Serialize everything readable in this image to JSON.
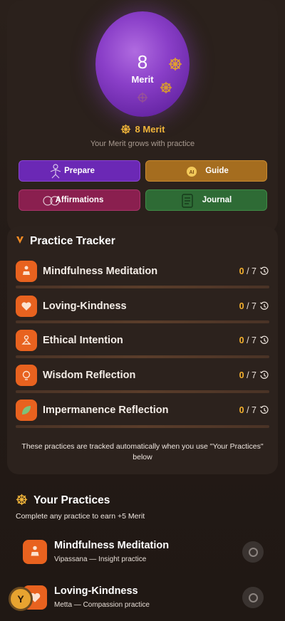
{
  "merit": {
    "value": "8",
    "label": "Merit",
    "summary": "8 Merit",
    "subtitle": "Your Merit grows with practice"
  },
  "actions": [
    {
      "label": "Prepare",
      "icon": "meditating-figure-icon",
      "color": "#6b28b5"
    },
    {
      "label": "Guide",
      "icon": "ai-guide-icon",
      "color": "#a56d1f"
    },
    {
      "label": "Affirmations",
      "icon": "speaking-heads-icon",
      "color": "#8a1f4f"
    },
    {
      "label": "Journal",
      "icon": "journal-icon",
      "color": "#2e6b35"
    }
  ],
  "tracker": {
    "title": "Practice Tracker",
    "items": [
      {
        "label": "Mindfulness Meditation",
        "done": "0",
        "goal": "/ 7"
      },
      {
        "label": "Loving-Kindness",
        "done": "0",
        "goal": "/ 7"
      },
      {
        "label": "Ethical Intention",
        "done": "0",
        "goal": "/ 7"
      },
      {
        "label": "Wisdom Reflection",
        "done": "0",
        "goal": "/ 7"
      },
      {
        "label": "Impermanence Reflection",
        "done": "0",
        "goal": "/ 7"
      }
    ],
    "note": "These practices are tracked automatically when you use \"Your Practices\" below"
  },
  "your_practices": {
    "title": "Your Practices",
    "subtitle": "Complete any practice to earn +5 Merit",
    "items": [
      {
        "name": "Mindfulness Meditation",
        "desc": "Vipassana — Insight practice"
      },
      {
        "name": "Loving-Kindness",
        "desc": "Metta — Compassion practice"
      }
    ]
  },
  "avatar": {
    "initial": "Y"
  },
  "colors": {
    "accent": "#f5b12e",
    "icon_bg": "#e8621f",
    "orb": "#8a3fc8"
  }
}
